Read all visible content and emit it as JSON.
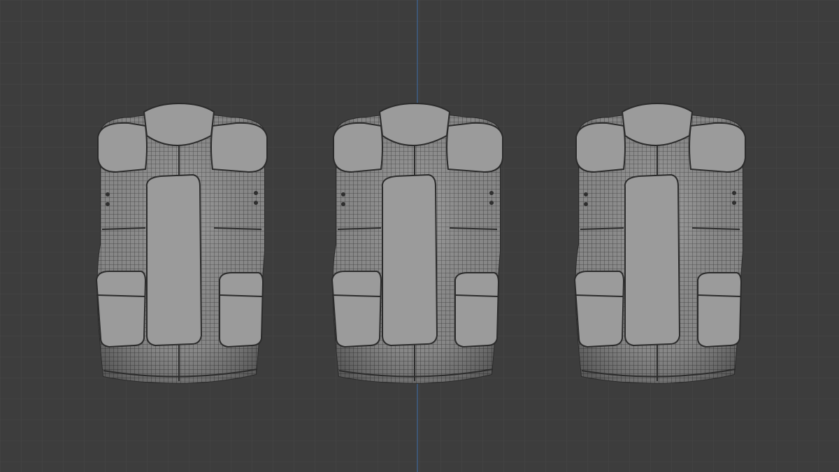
{
  "viewport": {
    "background": "#3d3d3d",
    "grid_color": "#4a4a4a",
    "axis_color": "#3f5e86",
    "mesh_color": "#8f8f8f",
    "wire_color": "#2a2a2a"
  },
  "scene": {
    "objects": [
      {
        "name": "vest-mesh-left",
        "icon": "mesh-object"
      },
      {
        "name": "vest-mesh-center",
        "icon": "mesh-object"
      },
      {
        "name": "vest-mesh-right",
        "icon": "mesh-object"
      }
    ]
  }
}
